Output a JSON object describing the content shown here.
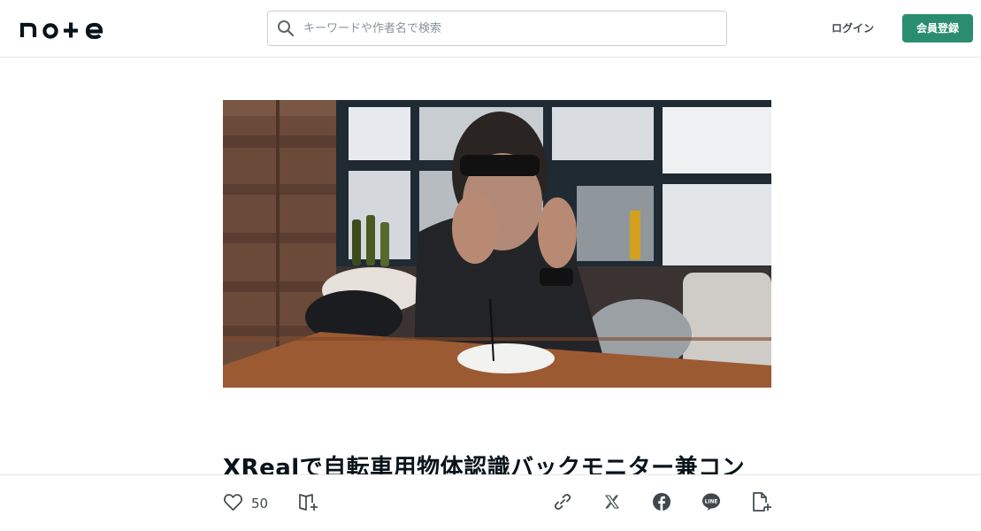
{
  "header": {
    "logo_text": "note",
    "search": {
      "placeholder": "キーワードや作者名で検索",
      "value": ""
    },
    "login_label": "ログイン",
    "signup_label": "会員登録"
  },
  "article": {
    "title": "XRealで自転車用物体認識バックモニター兼コン"
  },
  "actions": {
    "like_count": "50",
    "icons": [
      "heart-icon",
      "magazine-add-icon",
      "link-icon",
      "x-icon",
      "facebook-icon",
      "line-icon",
      "memo-add-icon"
    ]
  },
  "colors": {
    "accent": "#2b8d6f",
    "text": "#08131a",
    "icon": "#41484d"
  }
}
